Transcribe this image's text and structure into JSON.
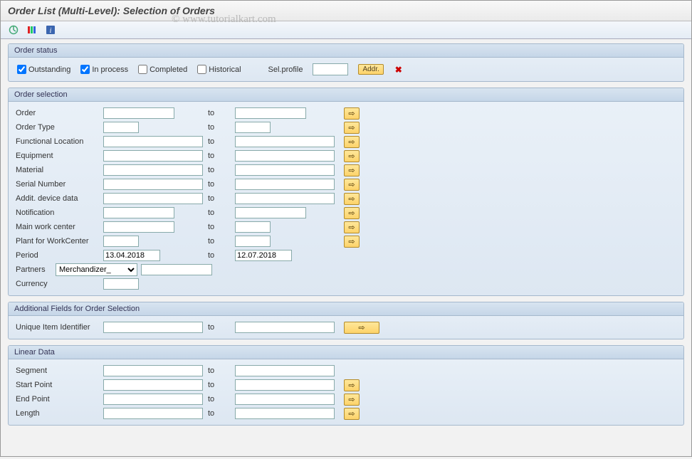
{
  "header": {
    "title": "Order List (Multi-Level): Selection of Orders"
  },
  "watermark": "© www.tutorialkart.com",
  "toolbar": {
    "execute_icon": "⊕",
    "variant_icon": "≣",
    "info_icon": "i"
  },
  "status_group": {
    "title": "Order status",
    "outstanding": {
      "label": "Outstanding",
      "checked": true
    },
    "in_process": {
      "label": "In process",
      "checked": true
    },
    "completed": {
      "label": "Completed",
      "checked": false
    },
    "historical": {
      "label": "Historical",
      "checked": false
    },
    "sel_profile_label": "Sel.profile",
    "sel_profile_value": "",
    "addr_button": "Addr.",
    "cancel_icon": "✖"
  },
  "selection_group": {
    "title": "Order selection",
    "to_label": "to",
    "rows": {
      "order": {
        "label": "Order",
        "from": "",
        "to": "",
        "from_cls": "w-med",
        "to_cls": "w-med",
        "opt": true
      },
      "order_type": {
        "label": "Order Type",
        "from": "",
        "to": "",
        "from_cls": "w-sm",
        "to_cls": "w-sm",
        "opt": true
      },
      "func_loc": {
        "label": "Functional Location",
        "from": "",
        "to": "",
        "from_cls": "w-lg",
        "to_cls": "w-lg",
        "opt": true
      },
      "equipment": {
        "label": "Equipment",
        "from": "",
        "to": "",
        "from_cls": "w-lg",
        "to_cls": "w-lg",
        "opt": true
      },
      "material": {
        "label": "Material",
        "from": "",
        "to": "",
        "from_cls": "w-lg",
        "to_cls": "w-lg",
        "opt": true
      },
      "serial": {
        "label": "Serial Number",
        "from": "",
        "to": "",
        "from_cls": "w-lg",
        "to_cls": "w-lg",
        "opt": true
      },
      "addit_dev": {
        "label": "Addit. device data",
        "from": "",
        "to": "",
        "from_cls": "w-lg",
        "to_cls": "w-lg",
        "opt": true
      },
      "notification": {
        "label": "Notification",
        "from": "",
        "to": "",
        "from_cls": "w-med",
        "to_cls": "w-med",
        "opt": true
      },
      "main_wc": {
        "label": "Main work center",
        "from": "",
        "to": "",
        "from_cls": "w-med",
        "to_cls": "w-sm",
        "opt": true
      },
      "plant_wc": {
        "label": "Plant for WorkCenter",
        "from": "",
        "to": "",
        "from_cls": "w-sm",
        "to_cls": "w-sm",
        "opt": true
      },
      "period": {
        "label": "Period",
        "from": "13.04.2018",
        "to": "12.07.2018",
        "from_cls": "",
        "to_cls": "",
        "opt": false
      }
    },
    "partners": {
      "label": "Partners",
      "selected": "Merchandizer_",
      "value": ""
    },
    "currency": {
      "label": "Currency",
      "value": ""
    }
  },
  "additional_group": {
    "title": "Additional Fields for Order Selection",
    "to_label": "to",
    "uid": {
      "label": "Unique Item Identifier",
      "from": "",
      "to": "",
      "opt": true
    }
  },
  "linear_group": {
    "title": "Linear Data",
    "to_label": "to",
    "rows": {
      "segment": {
        "label": "Segment",
        "from": "",
        "to": "",
        "opt": false
      },
      "start_point": {
        "label": "Start Point",
        "from": "",
        "to": "",
        "opt": true
      },
      "end_point": {
        "label": "End Point",
        "from": "",
        "to": "",
        "opt": true
      },
      "length": {
        "label": "Length",
        "from": "",
        "to": "",
        "opt": true
      }
    }
  },
  "icons": {
    "arrow": "⇨"
  }
}
